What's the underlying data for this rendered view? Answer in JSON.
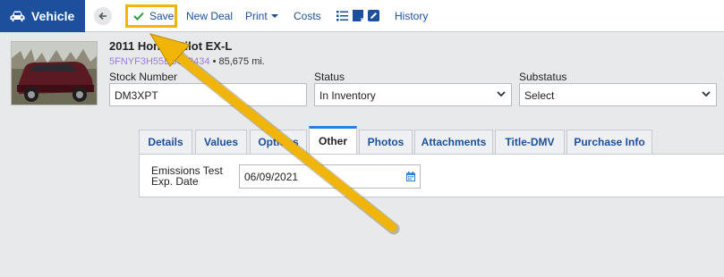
{
  "toolbar": {
    "brand": "Vehicle",
    "save_label": "Save",
    "new_deal": "New Deal",
    "print": "Print",
    "costs": "Costs",
    "history": "History"
  },
  "vehicle": {
    "title": "2011 Honda Pilot EX-L",
    "vin": "5FNYF3H55BB032434",
    "mileage": "85,675 mi."
  },
  "fields": {
    "stock_label": "Stock Number",
    "stock_value": "DM3XPT",
    "status_label": "Status",
    "status_value": "In Inventory",
    "substatus_label": "Substatus",
    "substatus_value": "Select"
  },
  "tabs": [
    "Details",
    "Values",
    "Options",
    "Other",
    "Photos",
    "Attachments",
    "Title-DMV",
    "Purchase Info"
  ],
  "active_tab": "Other",
  "other": {
    "emissions_label": "Emissions Test Exp. Date",
    "emissions_value": "06/09/2021"
  },
  "colors": {
    "brand": "#1c4f9c",
    "highlight": "#f1b50a",
    "vin": "#9b7be0",
    "tab_active": "#2b7fd6"
  }
}
